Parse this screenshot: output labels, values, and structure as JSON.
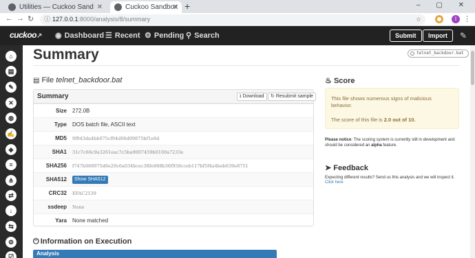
{
  "browser": {
    "tabs": [
      {
        "title": "Utilities — Cuckoo Sand"
      },
      {
        "title": "Cuckoo Sandbox"
      }
    ],
    "new_tab": "+",
    "window_controls": "– ▢ ✕",
    "url_host": "127.0.0.1",
    "url_path": ":8000/analysis/8/summary",
    "profile_initial": "I"
  },
  "navbar": {
    "logo": "cuckoo",
    "links": [
      "Dashboard",
      "Recent",
      "Pending",
      "Search"
    ],
    "submit": "Submit",
    "import": "Import"
  },
  "sidebar": {
    "icons": [
      "home-icon",
      "file-icon",
      "pen-icon",
      "network-icon",
      "globe-icon",
      "signature-icon",
      "process-icon",
      "bars-icon",
      "tree-icon",
      "shuffle-icon",
      "download-icon",
      "compare-icon",
      "settings-icon",
      "tasks-icon"
    ]
  },
  "page": {
    "title": "Summary",
    "file_tag": "telnet_backdoor.bat",
    "file_label": "File",
    "file_name": "telnet_backdoor.bat"
  },
  "summary_panel": {
    "title": "Summary",
    "download": "Download",
    "resubmit": "Resubmit sample",
    "rows": [
      {
        "label": "Size",
        "value": "272.0B"
      },
      {
        "label": "Type",
        "value": "DOS batch file, ASCII text"
      },
      {
        "label": "MD5",
        "value": "9f943da4bb075cf94d06d99875bf1e6d"
      },
      {
        "label": "SHA1",
        "value": "31c7c66c9a3261eac7c5ba9007459b0100a7233e"
      },
      {
        "label": "SHA256",
        "value": "f747b068975d6e20c6a034bcec38fe888b36f958cceb117bf5f4a4beb639e8751"
      },
      {
        "label": "SHA512",
        "value": "Show SHA512"
      },
      {
        "label": "CRC32",
        "value": "EFAC2539"
      },
      {
        "label": "ssdeep",
        "value": "None"
      },
      {
        "label": "Yara",
        "value": "None matched"
      }
    ]
  },
  "info_execution": {
    "title": "Information on Execution",
    "analysis_label": "Analysis"
  },
  "score": {
    "title": "Score",
    "message": "This file shows numerous signs of malicious behavior.",
    "line_prefix": "The score of this file is ",
    "value": "2.0 out of 10.",
    "notice_prefix": "Please notice",
    "notice_text": ": The scoring system is currently still in development and should be considered an ",
    "notice_alpha": "alpha",
    "notice_suffix": " feature."
  },
  "feedback": {
    "title": "Feedback",
    "text": "Expecting different results? Send us this analysis and we will inspect it.",
    "link": "Click here"
  },
  "colors": {
    "navbar_bg": "#222222",
    "sidebar_bg": "#2a2a2a",
    "accent_blue": "#337ab7",
    "warning_bg": "#fcf8e3",
    "warning_text": "#8a6d3b"
  }
}
